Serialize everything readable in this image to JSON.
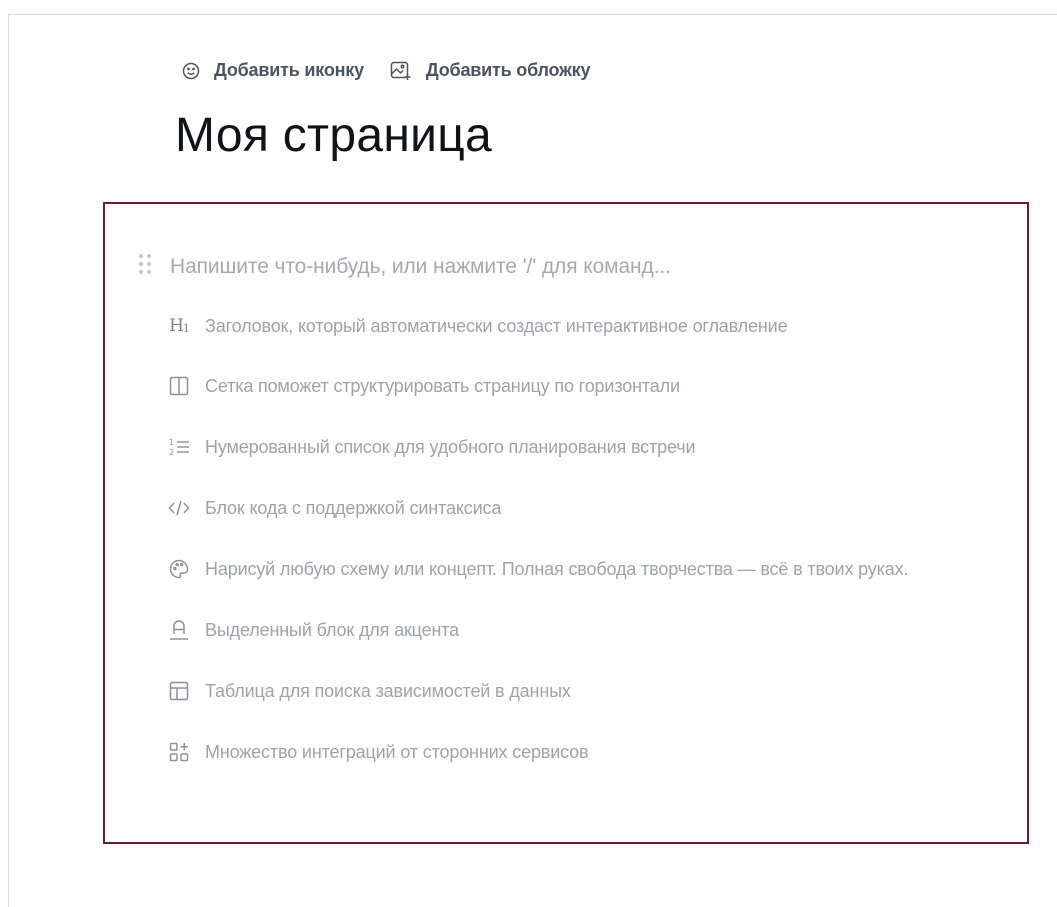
{
  "header": {
    "add_icon_label": "Добавить иконку",
    "add_cover_label": "Добавить обложку"
  },
  "page": {
    "title": "Моя страница"
  },
  "editor": {
    "placeholder": "Напишите что-нибудь, или нажмите '/' для команд...",
    "hints": [
      {
        "icon": "heading-icon",
        "text": "Заголовок, который автоматически создаст интерактивное оглавление"
      },
      {
        "icon": "columns-icon",
        "text": "Сетка поможет структурировать страницу по горизонтали"
      },
      {
        "icon": "numbered-list-icon",
        "text": "Нумерованный список для удобного планирования встречи"
      },
      {
        "icon": "code-icon",
        "text": "Блок кода с поддержкой синтаксиса"
      },
      {
        "icon": "palette-icon",
        "text": "Нарисуй любую схему или концепт. Полная свобода творчества — всё в твоих руках."
      },
      {
        "icon": "highlight-icon",
        "text": "Выделенный блок для акцента"
      },
      {
        "icon": "table-icon",
        "text": "Таблица для поиска зависимостей в данных"
      },
      {
        "icon": "integrations-icon",
        "text": "Множество интеграций от сторонних сервисов"
      }
    ]
  },
  "colors": {
    "frame_border": "#6b1a3a",
    "title": "#111318",
    "hint_text": "#9ea3ab",
    "action_text": "#4d5360"
  }
}
